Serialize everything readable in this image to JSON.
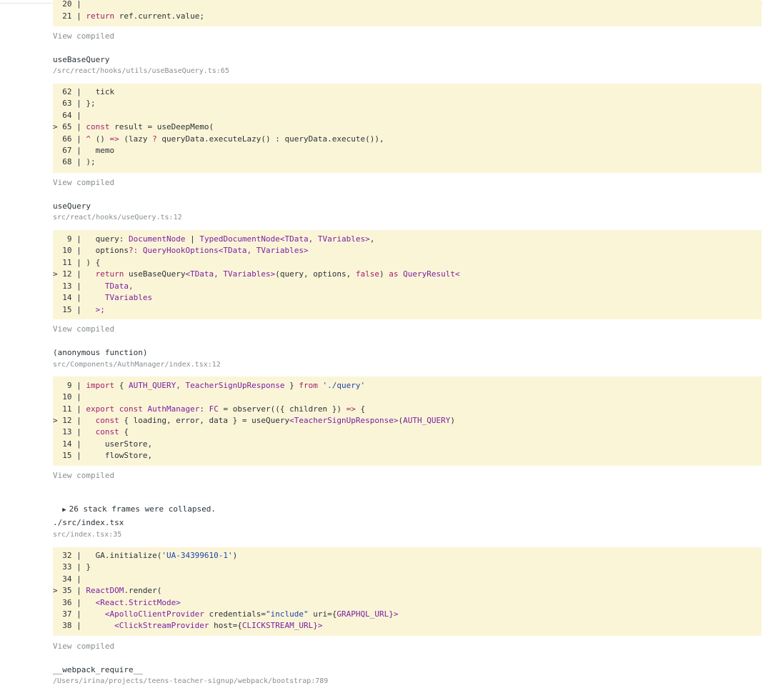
{
  "frames": [
    {
      "name": "",
      "path": "",
      "lines": [
        {
          "prefix": "  20 | ",
          "tokens": [
            {
              "t": "",
              "c": ""
            }
          ]
        },
        {
          "prefix": "  21 | ",
          "tokens": [
            {
              "t": "return",
              "c": "kw"
            },
            {
              "t": " ref.current.value;",
              "c": ""
            }
          ]
        }
      ],
      "view_compiled": "View compiled"
    },
    {
      "name": "useBaseQuery",
      "path": "/src/react/hooks/utils/useBaseQuery.ts:65",
      "lines": [
        {
          "prefix": "  62 | ",
          "tokens": [
            {
              "t": "  tick",
              "c": ""
            }
          ]
        },
        {
          "prefix": "  63 | ",
          "tokens": [
            {
              "t": "};",
              "c": ""
            }
          ]
        },
        {
          "prefix": "  64 | ",
          "tokens": [
            {
              "t": "",
              "c": ""
            }
          ]
        },
        {
          "prefix": "> 65 | ",
          "tokens": [
            {
              "t": "const",
              "c": "kw"
            },
            {
              "t": " result = useDeepMemo(",
              "c": ""
            }
          ]
        },
        {
          "prefix": "  66 | ",
          "tokens": [
            {
              "t": "^",
              "c": "kw"
            },
            {
              "t": " () ",
              "c": ""
            },
            {
              "t": "=>",
              "c": "op"
            },
            {
              "t": " (lazy ",
              "c": ""
            },
            {
              "t": "?",
              "c": "op"
            },
            {
              "t": " queryData.executeLazy() : queryData.execute()),",
              "c": ""
            }
          ]
        },
        {
          "prefix": "  67 | ",
          "tokens": [
            {
              "t": "  memo",
              "c": ""
            }
          ]
        },
        {
          "prefix": "  68 | ",
          "tokens": [
            {
              "t": ");",
              "c": ""
            }
          ]
        }
      ],
      "view_compiled": "View compiled"
    },
    {
      "name": "useQuery",
      "path": "src/react/hooks/useQuery.ts:12",
      "lines": [
        {
          "prefix": "   9 | ",
          "tokens": [
            {
              "t": "  query: ",
              "c": ""
            },
            {
              "t": "DocumentNode",
              "c": "ty"
            },
            {
              "t": " | ",
              "c": ""
            },
            {
              "t": "TypedDocumentNode<TData, TVariables>",
              "c": "ty"
            },
            {
              "t": ",",
              "c": ""
            }
          ]
        },
        {
          "prefix": "  10 | ",
          "tokens": [
            {
              "t": "  options",
              "c": ""
            },
            {
              "t": "?:",
              "c": "op"
            },
            {
              "t": " ",
              "c": ""
            },
            {
              "t": "QueryHookOptions<TData, TVariables>",
              "c": "ty"
            }
          ]
        },
        {
          "prefix": "  11 | ",
          "tokens": [
            {
              "t": ") {",
              "c": ""
            }
          ]
        },
        {
          "prefix": "> 12 | ",
          "tokens": [
            {
              "t": "  return",
              "c": "kw"
            },
            {
              "t": " useBaseQuery",
              "c": ""
            },
            {
              "t": "<TData, TVariables>",
              "c": "ty"
            },
            {
              "t": "(query, options, ",
              "c": ""
            },
            {
              "t": "false",
              "c": "kw"
            },
            {
              "t": ") ",
              "c": ""
            },
            {
              "t": "as",
              "c": "kw"
            },
            {
              "t": " ",
              "c": ""
            },
            {
              "t": "QueryResult<",
              "c": "ty"
            }
          ]
        },
        {
          "prefix": "  13 | ",
          "tokens": [
            {
              "t": "    TData,",
              "c": "ty"
            }
          ]
        },
        {
          "prefix": "  14 | ",
          "tokens": [
            {
              "t": "    TVariables",
              "c": "ty"
            }
          ]
        },
        {
          "prefix": "  15 | ",
          "tokens": [
            {
              "t": "  >;",
              "c": "ty"
            }
          ]
        }
      ],
      "view_compiled": "View compiled"
    },
    {
      "name": "(anonymous function)",
      "path": "src/Components/AuthManager/index.tsx:12",
      "lines": [
        {
          "prefix": "   9 | ",
          "tokens": [
            {
              "t": "import",
              "c": "kw"
            },
            {
              "t": " { ",
              "c": ""
            },
            {
              "t": "AUTH_QUERY, TeacherSignUpResponse",
              "c": "ty"
            },
            {
              "t": " } ",
              "c": ""
            },
            {
              "t": "from",
              "c": "kw"
            },
            {
              "t": " ",
              "c": ""
            },
            {
              "t": "'./query'",
              "c": "str"
            }
          ]
        },
        {
          "prefix": "  10 | ",
          "tokens": [
            {
              "t": "",
              "c": ""
            }
          ]
        },
        {
          "prefix": "  11 | ",
          "tokens": [
            {
              "t": "export const",
              "c": "kw"
            },
            {
              "t": " ",
              "c": ""
            },
            {
              "t": "AuthManager",
              "c": "ty"
            },
            {
              "t": ": ",
              "c": ""
            },
            {
              "t": "FC",
              "c": "ty"
            },
            {
              "t": " = observer(({ children }) ",
              "c": ""
            },
            {
              "t": "=>",
              "c": "op"
            },
            {
              "t": " {",
              "c": ""
            }
          ]
        },
        {
          "prefix": "> 12 | ",
          "tokens": [
            {
              "t": "  const",
              "c": "kw"
            },
            {
              "t": " { loading, error, data } = useQuery",
              "c": ""
            },
            {
              "t": "<TeacherSignUpResponse>",
              "c": "ty"
            },
            {
              "t": "(",
              "c": ""
            },
            {
              "t": "AUTH_QUERY",
              "c": "ty"
            },
            {
              "t": ")",
              "c": ""
            }
          ]
        },
        {
          "prefix": "  13 | ",
          "tokens": [
            {
              "t": "  const",
              "c": "kw"
            },
            {
              "t": " {",
              "c": ""
            }
          ]
        },
        {
          "prefix": "  14 | ",
          "tokens": [
            {
              "t": "    userStore,",
              "c": ""
            }
          ]
        },
        {
          "prefix": "  15 | ",
          "tokens": [
            {
              "t": "    flowStore,",
              "c": ""
            }
          ]
        }
      ],
      "view_compiled": "View compiled"
    },
    {
      "name": "./src/index.tsx",
      "path": "src/index.tsx:35",
      "lines": [
        {
          "prefix": "  32 | ",
          "tokens": [
            {
              "t": "  GA.initialize(",
              "c": ""
            },
            {
              "t": "'UA-34399610-1'",
              "c": "str"
            },
            {
              "t": ")",
              "c": ""
            }
          ]
        },
        {
          "prefix": "  33 | ",
          "tokens": [
            {
              "t": "}",
              "c": ""
            }
          ]
        },
        {
          "prefix": "  34 | ",
          "tokens": [
            {
              "t": "",
              "c": ""
            }
          ]
        },
        {
          "prefix": "> 35 | ",
          "tokens": [
            {
              "t": "ReactDOM",
              "c": "ty"
            },
            {
              "t": ".render(",
              "c": ""
            }
          ]
        },
        {
          "prefix": "  36 | ",
          "tokens": [
            {
              "t": "  <React.StrictMode>",
              "c": "ty"
            }
          ]
        },
        {
          "prefix": "  37 | ",
          "tokens": [
            {
              "t": "    <ApolloClientProvider",
              "c": "ty"
            },
            {
              "t": " credentials=",
              "c": ""
            },
            {
              "t": "\"include\"",
              "c": "str"
            },
            {
              "t": " uri={",
              "c": ""
            },
            {
              "t": "GRAPHQL_URL",
              "c": "ty"
            },
            {
              "t": "}>",
              "c": "ty"
            }
          ]
        },
        {
          "prefix": "  38 | ",
          "tokens": [
            {
              "t": "      <ClickStreamProvider",
              "c": "ty"
            },
            {
              "t": " host={",
              "c": ""
            },
            {
              "t": "CLICKSTREAM_URL",
              "c": "ty"
            },
            {
              "t": "}>",
              "c": "ty"
            }
          ]
        }
      ],
      "view_compiled": "View compiled"
    },
    {
      "name": "__webpack_require__",
      "path": "/Users/irina/projects/teens-teacher-signup/webpack/bootstrap:789",
      "lines": [],
      "view_compiled": ""
    }
  ],
  "collapsed": {
    "triangle": "▶",
    "label": "26 stack frames were collapsed."
  },
  "colors": {
    "code_background": "#fbf5d8",
    "keyword": "#a0206a",
    "type": "#7a1fa2",
    "string": "#1f45a8",
    "muted": "#878e91"
  }
}
